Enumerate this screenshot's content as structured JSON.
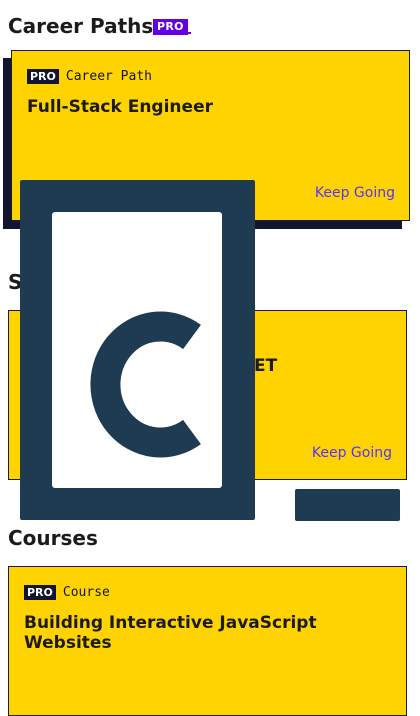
{
  "career_paths": {
    "heading": "Career Paths",
    "heading_badge": "PRO",
    "card": {
      "tag": "PRO",
      "type": "Career Path",
      "title": "Full-Stack Engineer",
      "action": "Keep Going"
    }
  },
  "skill_paths": {
    "heading_partial": "S",
    "card": {
      "title_partial": "ET",
      "action": "Keep Going"
    }
  },
  "courses": {
    "heading": "Courses",
    "card": {
      "tag": "PRO",
      "type": "Course",
      "title": "Building Interactive JavaScript Websites"
    }
  },
  "overlay": {
    "logo_icon": "codecademy-logo-icon"
  },
  "colors": {
    "card_yellow": "#ffd300",
    "navy": "#10162f",
    "pro_purple": "#6400e4",
    "link_blue": "#5533ff",
    "overlay_navy": "#1f3b52"
  }
}
